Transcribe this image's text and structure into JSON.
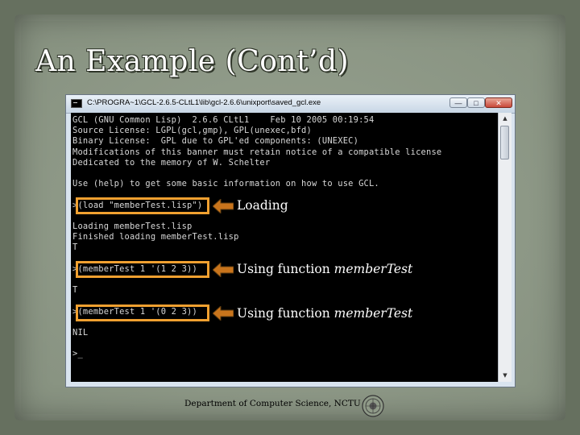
{
  "slide": {
    "title": "An Example (Cont’d)",
    "footer": "Department of Computer Science, NCTU"
  },
  "window": {
    "title": "C:\\PROGRA~1\\GCL-2.6.5-CLtL1\\lib\\gcl-2.6.6\\unixport\\saved_gcl.exe",
    "controls": {
      "minimize": "—",
      "maximize": "□",
      "close": "✕"
    }
  },
  "console": {
    "lines": [
      "GCL (GNU Common Lisp)  2.6.6 CLtL1    Feb 10 2005 00:19:54",
      "Source License: LGPL(gcl,gmp), GPL(unexec,bfd)",
      "Binary License:  GPL due to GPL'ed components: (UNEXEC)",
      "Modifications of this banner must retain notice of a compatible license",
      "Dedicated to the memory of W. Schelter",
      "",
      "Use (help) to get some basic information on how to use GCL.",
      "",
      ">(load \"memberTest.lisp\")",
      "",
      "Loading memberTest.lisp",
      "Finished loading memberTest.lisp",
      "T",
      "",
      ">(memberTest 1 '(1 2 3))",
      "",
      "T",
      "",
      ">(memberTest 1 '(0 2 3))",
      "",
      "NIL",
      "",
      ">_"
    ]
  },
  "annotations": [
    {
      "label": "Loading",
      "italic": ""
    },
    {
      "label": "Using function ",
      "italic": "memberTest"
    },
    {
      "label": "Using function ",
      "italic": "memberTest"
    }
  ],
  "colors": {
    "highlight": "#f0a030",
    "arrow_fill": "#c8741c",
    "background": "#66705f"
  },
  "icons": {
    "window": "console-app-icon",
    "scroll_up": "arrow-up-icon",
    "scroll_down": "arrow-down-icon",
    "pointer": "left-arrow-icon",
    "seal": "university-seal-icon"
  }
}
